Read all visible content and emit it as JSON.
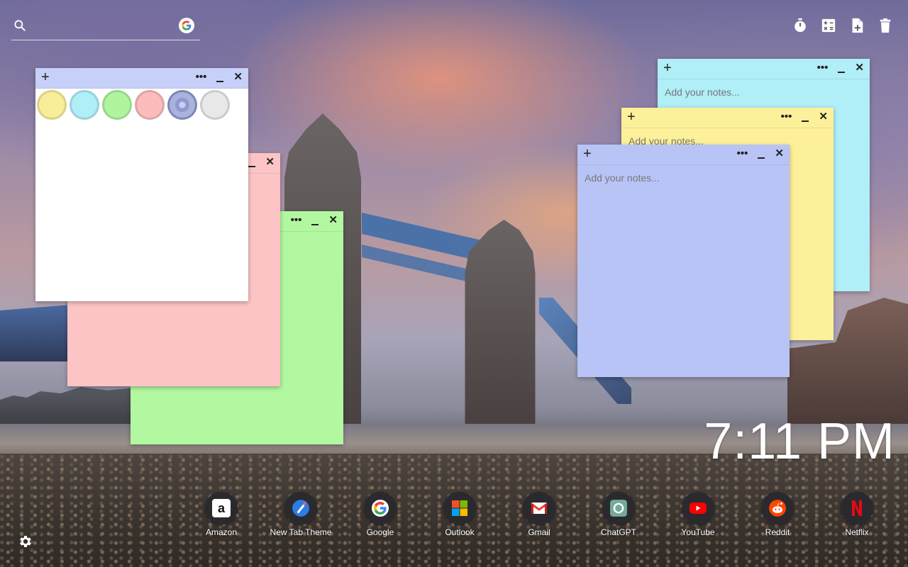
{
  "search": {
    "placeholder": "",
    "value": "",
    "engine_icon": "google-icon"
  },
  "toolbar": [
    {
      "icon": "timer-icon",
      "name": "timer-button"
    },
    {
      "icon": "calculator-icon",
      "name": "calculator-button"
    },
    {
      "icon": "add-note-icon",
      "name": "add-note-button"
    },
    {
      "icon": "trash-icon",
      "name": "delete-button"
    }
  ],
  "notes": {
    "placeholder": "Add your notes...",
    "menu_label": "•••",
    "add_label": "+",
    "close_label": "✕",
    "colors": {
      "blue": "#b0eef8",
      "yellow": "#fdf09a",
      "periwinkle": "#b8c4f6",
      "pink": "#fcc4c4",
      "green": "#b2f8a0",
      "white": "#ffffff"
    },
    "palette": [
      "#f8ee9a",
      "#b0eef8",
      "#b0f4a0",
      "#fcbcbc",
      "#8e9ad0",
      "#e8e8e8"
    ]
  },
  "clock": {
    "time": "7:11 PM"
  },
  "shortcuts": [
    {
      "label": "Amazon",
      "icon": "amazon-icon"
    },
    {
      "label": "New Tab Theme",
      "icon": "new-tab-theme-icon"
    },
    {
      "label": "Google",
      "icon": "google-icon"
    },
    {
      "label": "Outlook",
      "icon": "outlook-icon"
    },
    {
      "label": "Gmail",
      "icon": "gmail-icon"
    },
    {
      "label": "ChatGPT",
      "icon": "chatgpt-icon"
    },
    {
      "label": "YouTube",
      "icon": "youtube-icon"
    },
    {
      "label": "Reddit",
      "icon": "reddit-icon"
    },
    {
      "label": "Netflix",
      "icon": "netflix-icon"
    }
  ],
  "settings": {
    "icon": "gear-icon"
  }
}
